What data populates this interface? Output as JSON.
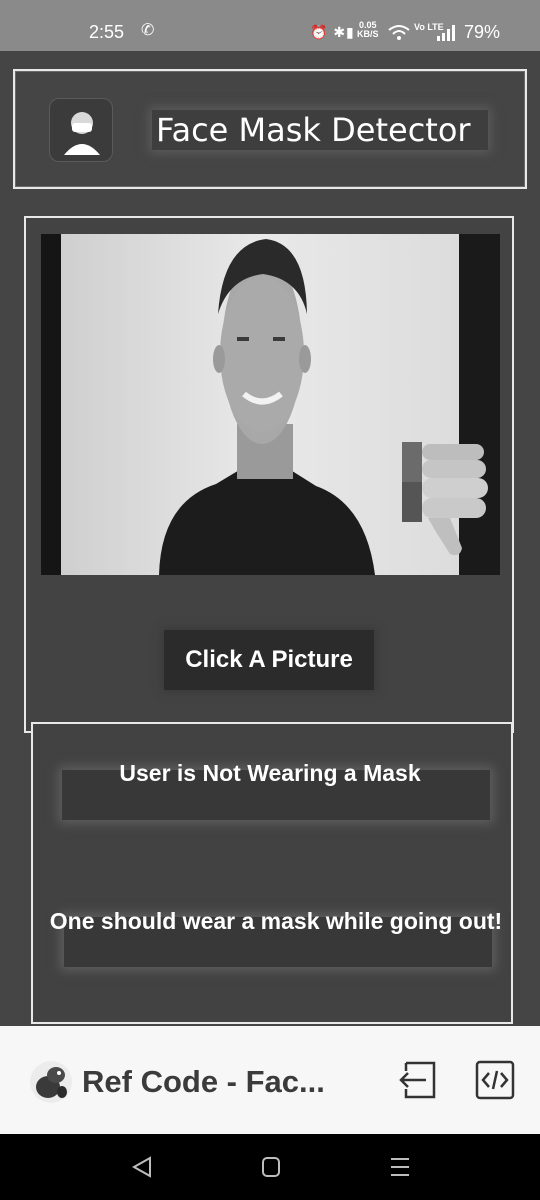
{
  "status_bar": {
    "time": "2:55",
    "call_icon": "phone-icon",
    "net_speed_value": "0.05",
    "net_speed_unit": "KB/S",
    "network_label": "Vo LTE",
    "battery": "79%"
  },
  "header": {
    "title": "Face Mask Detector",
    "logo_icon": "masked-person-icon"
  },
  "capture": {
    "status_icon": "thumbs-down-icon",
    "button_label": "Click A Picture"
  },
  "result": {
    "status": "User is Not Wearing a Mask",
    "advice": "One should wear a mask while going out!"
  },
  "bottom_bar": {
    "title": "Ref Code - Fac...",
    "exit_icon": "exit-icon",
    "code_icon": "code-icon"
  },
  "nav": {
    "back": "back-icon",
    "home": "home-icon",
    "recents": "recents-icon"
  }
}
